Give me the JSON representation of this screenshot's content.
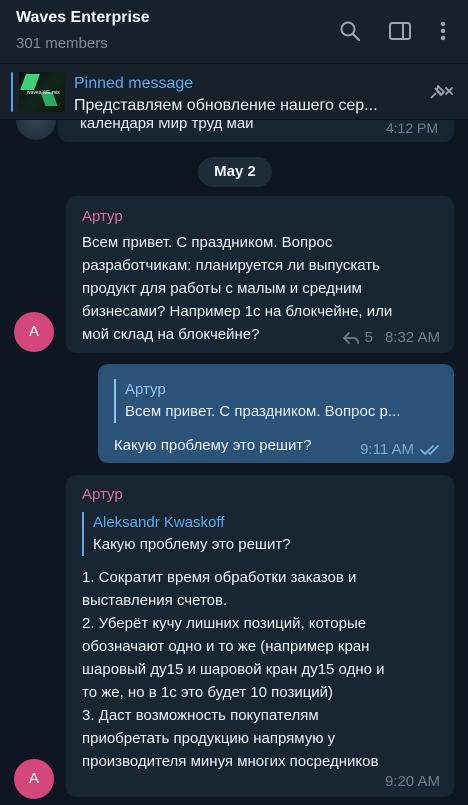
{
  "header": {
    "title": "Waves Enterprise",
    "subtitle": "301 members"
  },
  "pinned": {
    "label": "Pinned message",
    "text": "Представляем обновление нашего сер...",
    "thumb_text": "waves WE.mix"
  },
  "partial_message": {
    "text": "календаря Мир труд май",
    "time": "4:12 PM"
  },
  "date_separator": "May 2",
  "messages": [
    {
      "sender": "Артур",
      "lines": [
        "Всем привет. С праздником. Вопрос",
        "разработчикам: планируется ли выпускать",
        "продукт для работы с малым и средним",
        "бизнесами? Например 1с на блокчейне, или",
        "мой склад на блокчейне?"
      ],
      "replies": "5",
      "time": "8:32 AM",
      "avatar_letter": "A"
    },
    {
      "quote_name": "Артур",
      "quote_text": "Всем привет. С праздником. Вопрос р...",
      "text": "Какую проблему это решит?",
      "time": "9:11 AM"
    },
    {
      "sender": "Артур",
      "quote_name": "Aleksandr Kwaskoff",
      "quote_text": "Какую проблему это решит?",
      "lines": [
        "1. Сократит время обработки заказов и",
        "выставления счетов.",
        "2. Уберёт кучу лишних позиций, которые",
        "обозначают одно и то же (например кран",
        "шаровый ду15 и шаровой кран ду15 одно и",
        "то же, но в 1с это будет 10 позиций)",
        "3. Даст возможность покупателям",
        "приобретать продукцию напрямую у",
        "производителя минуя многих посредников"
      ],
      "time": "9:20 AM",
      "avatar_letter": "A"
    }
  ],
  "colors": {
    "background": "#0e1621",
    "header": "#17212b",
    "incoming": "#182533",
    "outgoing": "#2b5278",
    "accent": "#5eaaea",
    "sender": "#e06c9f",
    "avatar": "#d4477a"
  },
  "icons": [
    "search-icon",
    "sidebar-toggle-icon",
    "more-vertical-icon",
    "unpin-icon",
    "reply-arrow-icon",
    "double-check-icon"
  ]
}
